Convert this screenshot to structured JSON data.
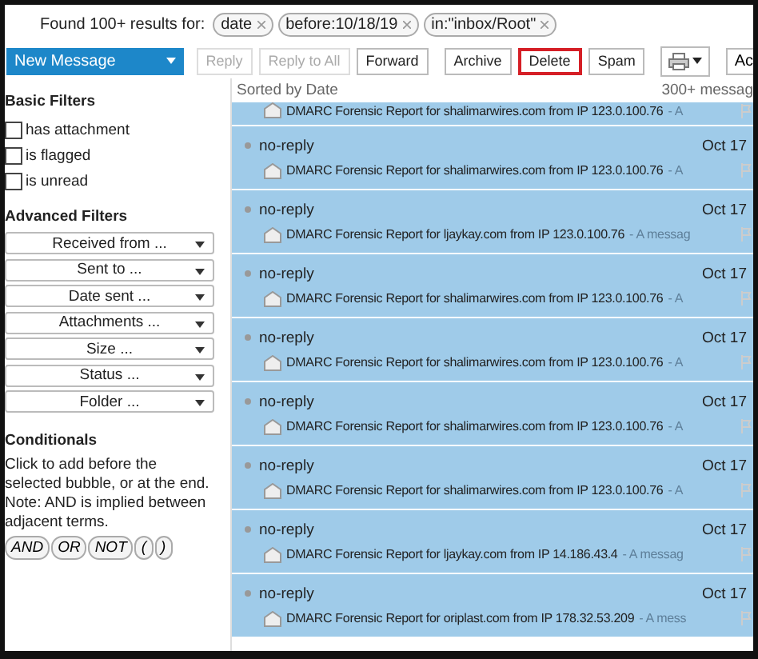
{
  "search": {
    "label": "Found 100+ results for:",
    "bubbles": [
      "date",
      "before:10/18/19",
      "in:\"inbox/Root\""
    ]
  },
  "new_message": "New Message",
  "toolbar": [
    {
      "label": "Reply",
      "disabled": true,
      "selected": false
    },
    {
      "label": "Reply to All",
      "disabled": true,
      "selected": false
    },
    {
      "label": "Forward",
      "disabled": false,
      "selected": false
    },
    {
      "label": "Archive",
      "disabled": false,
      "selected": false
    },
    {
      "label": "Delete",
      "disabled": false,
      "selected": true
    },
    {
      "label": "Spam",
      "disabled": false,
      "selected": false
    }
  ],
  "cut_button": "Ac",
  "basic_filters": {
    "title": "Basic Filters",
    "items": [
      {
        "label": "has attachment",
        "checked": false
      },
      {
        "label": "is flagged",
        "checked": false
      },
      {
        "label": "is unread",
        "checked": false
      }
    ]
  },
  "advanced_filters": {
    "title": "Advanced Filters",
    "dropdowns": [
      "Received from ...",
      "Sent to ...",
      "Date sent ...",
      "Attachments ...",
      "Size ...",
      "Status ...",
      "Folder ..."
    ]
  },
  "conditionals": {
    "title": "Conditionals",
    "text": "Click to add before the selected bubble, or at the end. Note: AND is implied between adjacent terms.",
    "operators": [
      "AND",
      "OR",
      "NOT",
      "(",
      ")"
    ]
  },
  "list": {
    "sort_label": "Sorted by Date",
    "count": "300+ messag",
    "messages": [
      {
        "kind": "partial",
        "selected": true,
        "subject": "DMARC Forensic Report for shalimarwires.com from IP 123.0.100.76",
        "preview": "- A"
      },
      {
        "kind": "full",
        "selected": true,
        "sender": "no-reply",
        "date": "Oct 17",
        "subject": "DMARC Forensic Report for shalimarwires.com from IP 123.0.100.76",
        "preview": "- A"
      },
      {
        "kind": "full",
        "selected": true,
        "sender": "no-reply",
        "date": "Oct 17",
        "subject": "DMARC Forensic Report for ljaykay.com from IP 123.0.100.76",
        "preview": "- A messag"
      },
      {
        "kind": "full",
        "selected": true,
        "sender": "no-reply",
        "date": "Oct 17",
        "subject": "DMARC Forensic Report for shalimarwires.com from IP 123.0.100.76",
        "preview": "- A"
      },
      {
        "kind": "full",
        "selected": true,
        "sender": "no-reply",
        "date": "Oct 17",
        "subject": "DMARC Forensic Report for shalimarwires.com from IP 123.0.100.76",
        "preview": "- A"
      },
      {
        "kind": "full",
        "selected": true,
        "sender": "no-reply",
        "date": "Oct 17",
        "subject": "DMARC Forensic Report for shalimarwires.com from IP 123.0.100.76",
        "preview": "- A"
      },
      {
        "kind": "full",
        "selected": true,
        "sender": "no-reply",
        "date": "Oct 17",
        "subject": "DMARC Forensic Report for shalimarwires.com from IP 123.0.100.76",
        "preview": "- A"
      },
      {
        "kind": "full",
        "selected": true,
        "sender": "no-reply",
        "date": "Oct 17",
        "subject": "DMARC Forensic Report for ljaykay.com from IP 14.186.43.4",
        "preview": "- A messag"
      },
      {
        "kind": "full",
        "selected": true,
        "sender": "no-reply",
        "date": "Oct 17",
        "subject": "DMARC Forensic Report for oriplast.com from IP 178.32.53.209",
        "preview": "- A mess"
      }
    ]
  }
}
